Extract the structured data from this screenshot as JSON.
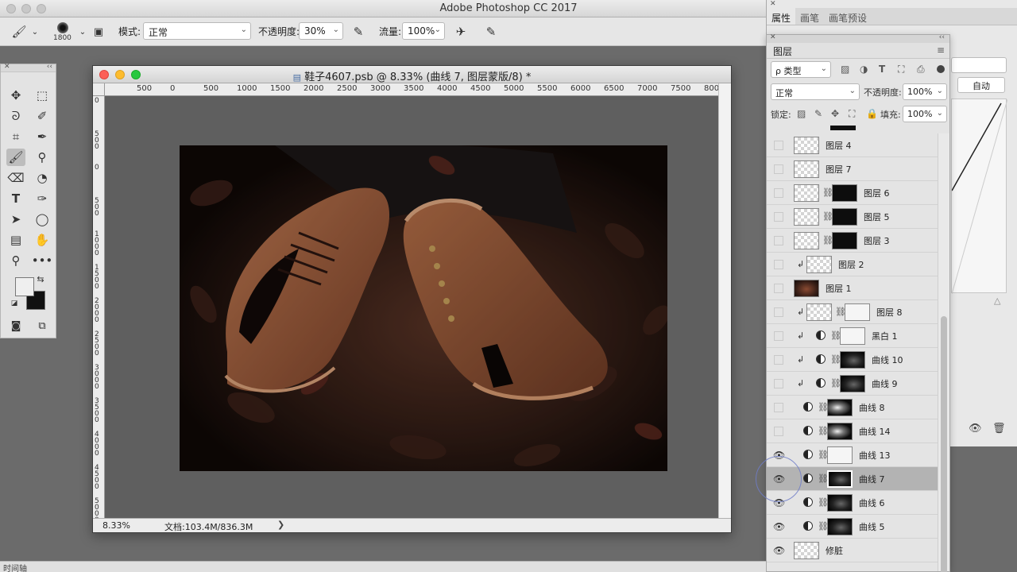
{
  "app": {
    "title": "Adobe Photoshop CC 2017"
  },
  "options": {
    "brush_size": "1800",
    "mode_label": "模式:",
    "mode_value": "正常",
    "opacity_label": "不透明度:",
    "opacity_value": "30%",
    "flow_label": "流量:",
    "flow_value": "100%"
  },
  "document": {
    "title": "鞋子4607.psb @ 8.33% (曲线 7, 图层蒙版/8) *",
    "ruler_h_labels": [
      "500",
      "0",
      "500",
      "1000",
      "1500",
      "2000",
      "2500",
      "3000",
      "3500",
      "4000",
      "4500",
      "5000",
      "5500",
      "6000",
      "6500",
      "7000",
      "7500",
      "8000"
    ],
    "ruler_v_labels": [
      "0",
      "5 0 0",
      "0",
      "5 0 0",
      "1 0 0 0",
      "1 5 0 0",
      "2 0 0 0",
      "2 5 0 0",
      "3 0 0 0",
      "3 5 0 0",
      "4 0 0 0",
      "4 5 0 0",
      "5 0 0 0",
      "5 5 0 0"
    ],
    "status_zoom": "8.33%",
    "status_doc": "文档:103.4M/836.3M"
  },
  "properties": {
    "tabs": [
      "属性",
      "画笔",
      "画笔预设"
    ],
    "auto_button": "自动"
  },
  "layers_panel": {
    "title": "图层",
    "filter_kind": "ρ 类型",
    "blend_mode": "正常",
    "opacity_label": "不透明度:",
    "opacity_value": "100%",
    "lock_label": "锁定:",
    "fill_label": "填充:",
    "fill_value": "100%",
    "layers": [
      {
        "name": "图层 4",
        "visible": false,
        "clip": false,
        "adjustment": false,
        "thumb": "checker",
        "mask": null,
        "selected": false
      },
      {
        "name": "图层 7",
        "visible": false,
        "clip": false,
        "adjustment": false,
        "thumb": "checker",
        "mask": null,
        "selected": false
      },
      {
        "name": "图层 6",
        "visible": false,
        "clip": false,
        "adjustment": false,
        "thumb": "checker",
        "mask": "black",
        "selected": false
      },
      {
        "name": "图层 5",
        "visible": false,
        "clip": false,
        "adjustment": false,
        "thumb": "checker",
        "mask": "black",
        "selected": false
      },
      {
        "name": "图层 3",
        "visible": false,
        "clip": false,
        "adjustment": false,
        "thumb": "checker",
        "mask": "black",
        "selected": false
      },
      {
        "name": "图层 2",
        "visible": false,
        "clip": true,
        "adjustment": false,
        "thumb": "checker",
        "mask": null,
        "selected": false
      },
      {
        "name": "图层 1",
        "visible": false,
        "clip": false,
        "adjustment": false,
        "thumb": "photo",
        "mask": null,
        "selected": false
      },
      {
        "name": "图层 8",
        "visible": false,
        "clip": true,
        "adjustment": false,
        "thumb": "checker",
        "mask": "white",
        "selected": false
      },
      {
        "name": "黑白 1",
        "visible": false,
        "clip": true,
        "adjustment": true,
        "thumb": null,
        "mask": "white",
        "selected": false
      },
      {
        "name": "曲线 10",
        "visible": false,
        "clip": true,
        "adjustment": true,
        "thumb": null,
        "mask": "soft",
        "selected": false
      },
      {
        "name": "曲线 9",
        "visible": false,
        "clip": true,
        "adjustment": true,
        "thumb": null,
        "mask": "soft",
        "selected": false
      },
      {
        "name": "曲线 8",
        "visible": false,
        "clip": false,
        "adjustment": true,
        "thumb": null,
        "mask": "mix",
        "selected": false
      },
      {
        "name": "曲线 14",
        "visible": false,
        "clip": false,
        "adjustment": true,
        "thumb": null,
        "mask": "mix",
        "selected": false
      },
      {
        "name": "曲线 13",
        "visible": true,
        "clip": false,
        "adjustment": true,
        "thumb": null,
        "mask": "white",
        "selected": false
      },
      {
        "name": "曲线 7",
        "visible": true,
        "clip": false,
        "adjustment": true,
        "thumb": null,
        "mask": "soft",
        "selected": true
      },
      {
        "name": "曲线 6",
        "visible": true,
        "clip": false,
        "adjustment": true,
        "thumb": null,
        "mask": "soft",
        "selected": false
      },
      {
        "name": "曲线 5",
        "visible": true,
        "clip": false,
        "adjustment": true,
        "thumb": null,
        "mask": "soft",
        "selected": false
      },
      {
        "name": "修脏",
        "visible": true,
        "clip": false,
        "adjustment": false,
        "thumb": "checker",
        "mask": null,
        "selected": false
      }
    ]
  },
  "timeline": {
    "label": "时间轴"
  }
}
